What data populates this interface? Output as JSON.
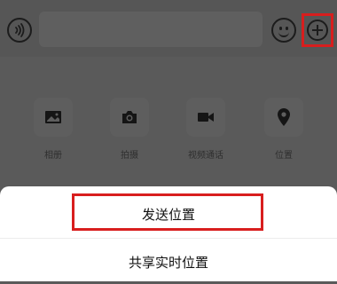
{
  "chat_bar": {
    "voice_icon": "voice-icon",
    "input_placeholder": "",
    "emoji_icon": "emoji-icon",
    "plus_icon": "plus-circle-icon",
    "plus_highlight_color": "#d81e1e"
  },
  "tools": [
    {
      "label": "相册",
      "icon": "photo-album-icon"
    },
    {
      "label": "拍摄",
      "icon": "camera-icon"
    },
    {
      "label": "视频通话",
      "icon": "video-call-icon"
    },
    {
      "label": "位置",
      "icon": "location-pin-icon"
    }
  ],
  "action_sheet": {
    "send_location_label": "发送位置",
    "share_live_location_label": "共享实时位置",
    "highlight_color": "#d81e1e"
  }
}
